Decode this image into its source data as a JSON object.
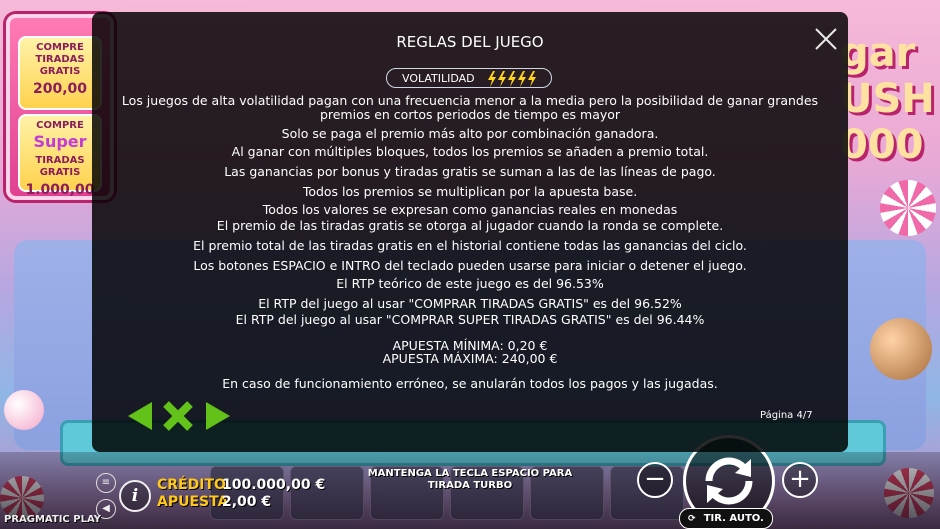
{
  "background": {
    "promo_buy_free_spins": {
      "title": "COMPRE TIRADAS GRATIS",
      "price": "200,00"
    },
    "promo_buy_super": {
      "title": "COMPRE",
      "super": "Super",
      "title2": "TIRADAS GRATIS",
      "price": "1.000,00"
    },
    "logo": {
      "line1": "gar",
      "line2": "USH",
      "line3": "000"
    }
  },
  "dialog": {
    "title": "REGLAS DEL JUEGO",
    "volatility_label": "VOLATILIDAD",
    "volatility_level": 5,
    "paragraphs": [
      "Los juegos de alta volatilidad pagan con una frecuencia menor a la media pero la posibilidad de ganar grandes premios en cortos periodos de tiempo es mayor",
      "Solo se paga el premio más alto por combinación ganadora.",
      "Al ganar con múltiples bloques, todos los premios se añaden a premio total.",
      "Las ganancias por bonus y tiradas gratis se suman a las de las líneas de pago.",
      "Todos los premios se multiplican por la apuesta base.",
      "Todos los valores se expresan como ganancias reales en monedas",
      "El premio de las tiradas gratis se otorga al jugador cuando la ronda se complete.",
      "El premio total de las tiradas gratis en el historial contiene todas las ganancias del ciclo.",
      "Los botones ESPACIO e INTRO del teclado pueden usarse para iniciar o detener el juego.",
      "El RTP teórico de este juego es del 96.53%",
      "El RTP del juego al usar \"COMPRAR TIRADAS GRATIS\" es del 96.52%",
      "El RTP del juego al usar \"COMPRAR SUPER TIRADAS GRATIS\" es del 96.44%",
      "APUESTA MÍNIMA: 0,20 €",
      "APUESTA MÁXIMA: 240,00 €",
      "En caso de funcionamiento erróneo, se anularán todos los pagos y las jugadas."
    ],
    "page_indicator": "Página 4/7"
  },
  "bottom_bar": {
    "credit_label": "CRÉDITO",
    "credit_value": "100.000,00 €",
    "bet_label": "APUESTA",
    "bet_value": "2,00 €",
    "spin_hint": "MANTENGA LA TECLA ESPACIO PARA TIRADA TURBO",
    "autoplay_label": "TIR. AUTO.",
    "provider": "PRAGMATIC PLAY",
    "minus_symbol": "−",
    "plus_symbol": "+",
    "info_symbol": "i"
  },
  "colors": {
    "accent_gold": "#ffc81a",
    "nav_green": "#63c21a",
    "bolt_yellow": "#ffd21f",
    "dialog_bg": "rgba(0,0,0,0.84)"
  },
  "icons": [
    "close-icon",
    "lightning-bolt-icon",
    "arrow-left-icon",
    "x-icon",
    "arrow-right-icon",
    "menu-icon",
    "sound-icon",
    "info-icon",
    "spin-icon",
    "minus-icon",
    "plus-icon"
  ]
}
